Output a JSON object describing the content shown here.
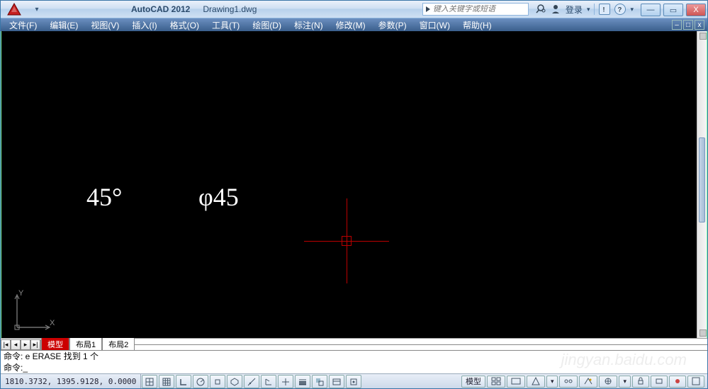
{
  "titlebar": {
    "app_name": "AutoCAD 2012",
    "doc_name": "Drawing1.dwg",
    "search_placeholder": "键入关键字或短语",
    "login_label": "登录"
  },
  "menubar": {
    "items": [
      "文件(F)",
      "编辑(E)",
      "视图(V)",
      "插入(I)",
      "格式(O)",
      "工具(T)",
      "绘图(D)",
      "标注(N)",
      "修改(M)",
      "参数(P)",
      "窗口(W)",
      "帮助(H)"
    ]
  },
  "canvas": {
    "text1": "45°",
    "text2": "φ45",
    "ucs_y": "Y",
    "ucs_x": "X"
  },
  "tabs": {
    "model": "模型",
    "layout1": "布局1",
    "layout2": "布局2"
  },
  "command": {
    "line1": "命令: e ERASE 找到 1 个",
    "line2": "命令:"
  },
  "status": {
    "coords": "1810.3732, 1395.9128, 0.0000",
    "model_btn": "模型"
  },
  "watermark": "jingyan.baidu.com"
}
